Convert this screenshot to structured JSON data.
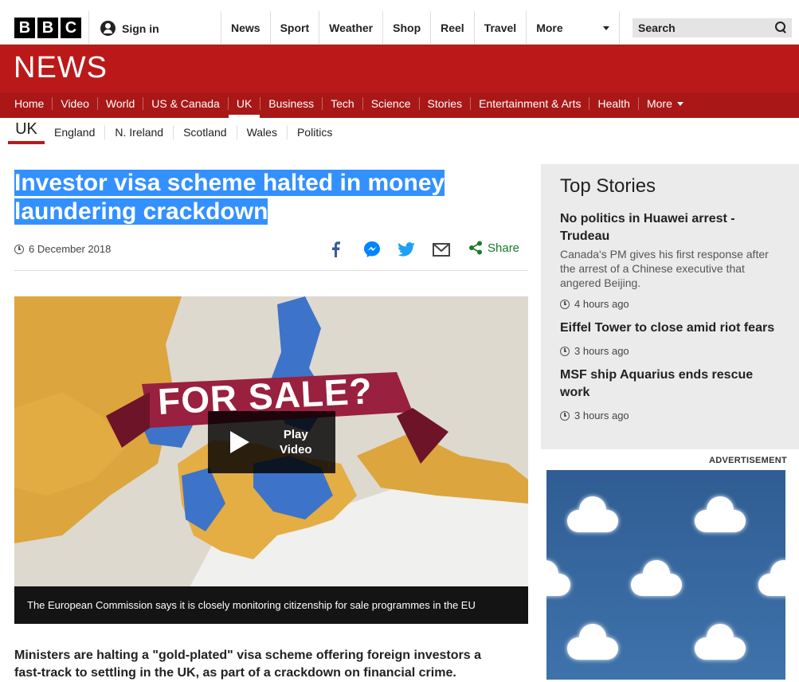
{
  "header": {
    "logo": [
      "B",
      "B",
      "C"
    ],
    "signin_label": "Sign in",
    "nav": [
      "News",
      "Sport",
      "Weather",
      "Shop",
      "Reel",
      "Travel"
    ],
    "more_label": "More",
    "search_label": "Search"
  },
  "news": {
    "logo": "NEWS",
    "sections": [
      "Home",
      "Video",
      "World",
      "US & Canada",
      "UK",
      "Business",
      "Tech",
      "Science",
      "Stories",
      "Entertainment & Arts",
      "Health",
      "More"
    ],
    "active_section": "UK"
  },
  "subnav": {
    "current": "UK",
    "items": [
      "England",
      "N. Ireland",
      "Scotland",
      "Wales",
      "Politics"
    ]
  },
  "article": {
    "headline_line1": "Investor visa scheme halted in money",
    "headline_line2": "laundering crackdown",
    "date": "6 December 2018",
    "share_label": "Share",
    "video_banner_text": "FOR SALE?",
    "play_label_1": "Play",
    "play_label_2": "Video",
    "caption": "The European Commission says it is closely monitoring citizenship for sale programmes in the EU",
    "lede": "Ministers are halting a \"gold-plated\" visa scheme offering foreign investors a fast-track to settling in the UK, as part of a crackdown on financial crime."
  },
  "top_stories": {
    "title": "Top Stories",
    "stories": [
      {
        "title": "No politics in Huawei arrest - Trudeau",
        "summary": "Canada's PM gives his first response after the arrest of a Chinese executive that angered Beijing.",
        "time": "4 hours ago"
      },
      {
        "title": "Eiffel Tower to close amid riot fears",
        "summary": "",
        "time": "3 hours ago"
      },
      {
        "title": "MSF ship Aquarius ends rescue work",
        "summary": "",
        "time": "3 hours ago"
      }
    ]
  },
  "advertisement_label": "ADVERTISEMENT",
  "colors": {
    "brand_red": "#bb1919",
    "highlight": "#3390ff",
    "share_green": "#1a7b2a",
    "facebook": "#3b5998",
    "messenger": "#0084ff",
    "twitter": "#1da1f2"
  }
}
